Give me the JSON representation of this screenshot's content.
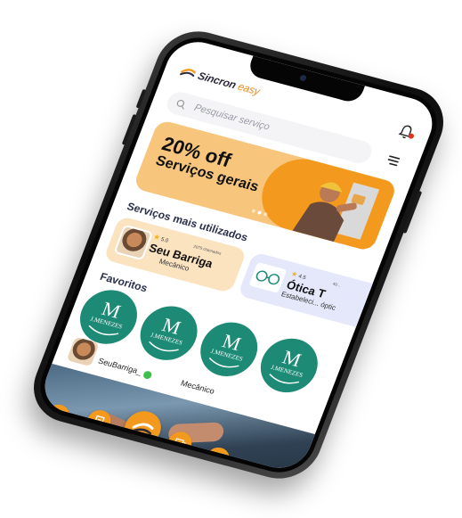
{
  "app": {
    "logo_name": "Sincron",
    "logo_accent": "easy",
    "brand_color": "#f39a1e",
    "brand_dark": "#2b2b3a"
  },
  "search": {
    "placeholder": "Pesquisar serviço"
  },
  "banner": {
    "title": "20% off",
    "subtitle": "Serviços gerais",
    "slide_count": 3,
    "active_slide": 2
  },
  "sections": {
    "most_used": "Serviços mais utilizados",
    "favorites": "Favoritos"
  },
  "services": [
    {
      "rating": "5.0",
      "calls": "2075 chamados",
      "name": "Seu Barriga",
      "role": "Mecânico"
    },
    {
      "rating": "4.5",
      "calls": "40...",
      "name": "Ótica T",
      "role": "Estabeleci... óptic"
    }
  ],
  "favorites": [
    {
      "name": "J.MENEZES"
    },
    {
      "name": "J.MENEZES"
    },
    {
      "name": "J.MENEZES"
    },
    {
      "name": "J.MENEZES"
    }
  ],
  "list_item": {
    "name": "SeuBarriga_",
    "role": "Mecânico",
    "status": "online"
  },
  "nav": {
    "items": [
      "home-icon",
      "document-icon",
      "logo-icon",
      "chat-icon",
      "profile-icon"
    ]
  }
}
